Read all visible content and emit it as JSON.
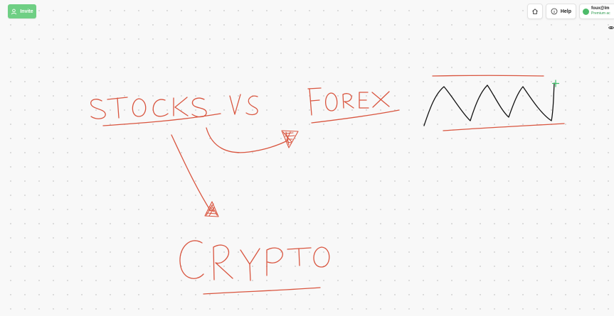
{
  "toolbar": {
    "invite_label": "Invite",
    "help_label": "Help",
    "account_email": "foux@lm",
    "account_plan": "Premium ac"
  },
  "canvas": {
    "words": [
      "STOCKS",
      "VS",
      "FOREX",
      "CRYPTO"
    ],
    "ink_colors": {
      "red": "#d9553f",
      "black": "#111111",
      "green": "#3fbf6a"
    }
  },
  "icons": {
    "invite": "user-icon",
    "home": "home-icon",
    "help": "info-icon",
    "account": "avatar-icon",
    "visibility": "eye-icon"
  }
}
